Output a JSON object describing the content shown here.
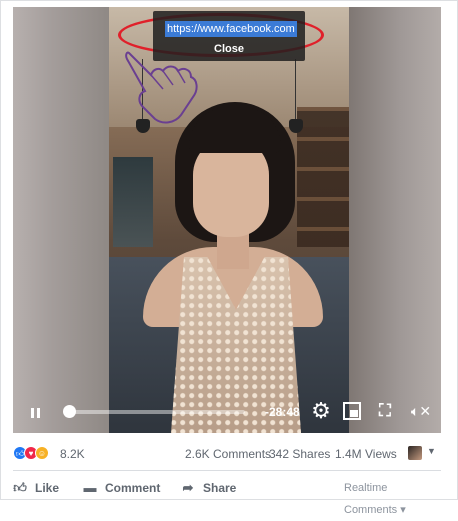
{
  "popup": {
    "url": "https://www.facebook.com",
    "close_label": "Close"
  },
  "player": {
    "progress": 0.0,
    "time_remaining": "-28:48",
    "icons": {
      "pause": "pause-icon",
      "settings": "gear-icon",
      "pip": "picture-in-picture-icon",
      "fullscreen": "fullscreen-icon",
      "mute": "volume-muted-icon"
    }
  },
  "stats": {
    "reactions": [
      "like",
      "love",
      "haha"
    ],
    "reaction_count": "8.2K",
    "comments": "2.6K Comments",
    "shares": "342 Shares",
    "views": "1.4M Views"
  },
  "actions": {
    "like": "Like",
    "comment": "Comment",
    "share": "Share",
    "realtime": "Realtime Comments"
  },
  "colors": {
    "facebook_blue": "#2078f4",
    "highlight_ring": "#e0202a",
    "selection": "#3b7bd6"
  }
}
